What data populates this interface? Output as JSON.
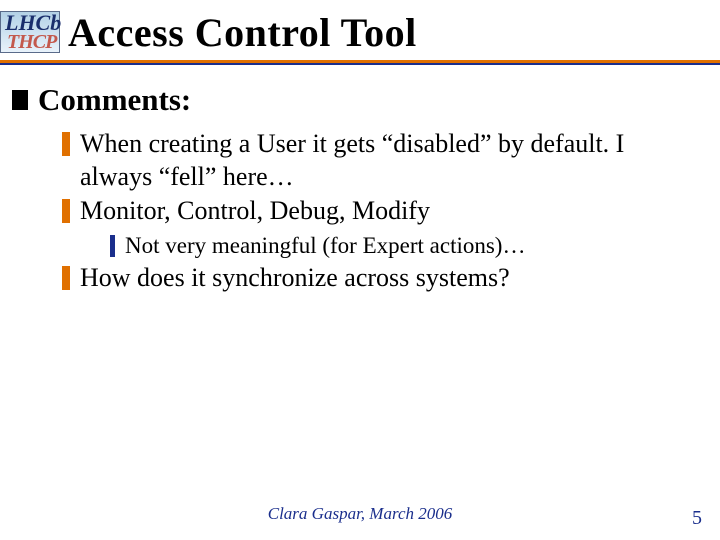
{
  "logo": {
    "top": "LHCb",
    "bottom": "THCP"
  },
  "title": "Access Control Tool",
  "bullets": {
    "l1": "Comments:",
    "l2a": "When creating a User it gets “disabled” by default. I always “fell” here…",
    "l2b": "Monitor, Control, Debug, Modify",
    "l3a": "Not very meaningful (for Expert actions)…",
    "l2c": "How does it synchronize across systems?"
  },
  "footer": {
    "center": "Clara Gaspar, March 2006",
    "right": "5"
  }
}
